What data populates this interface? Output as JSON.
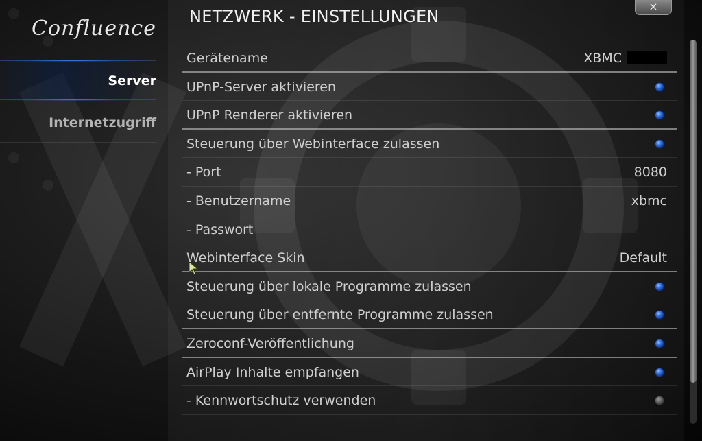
{
  "app": {
    "logo_text": "Confluence",
    "page_title": "NETZWERK - EINSTELLUNGEN",
    "close_label": "×"
  },
  "sidebar": {
    "items": [
      {
        "label": "Server",
        "active": true
      },
      {
        "label": "Internetzugriff",
        "active": false
      }
    ]
  },
  "settings": [
    {
      "label": "Gerätename",
      "value": "XBMC",
      "type": "text",
      "redacted": true,
      "separator": true
    },
    {
      "label": "UPnP-Server aktivieren",
      "type": "radio",
      "checked": true
    },
    {
      "label": "UPnP Renderer aktivieren",
      "type": "radio",
      "checked": true,
      "separator": true
    },
    {
      "label": "Steuerung über Webinterface zulassen",
      "type": "radio",
      "checked": true
    },
    {
      "label": "- Port",
      "value": "8080",
      "type": "text"
    },
    {
      "label": "- Benutzername",
      "value": "xbmc",
      "type": "text"
    },
    {
      "label": "- Passwort",
      "value": "",
      "type": "text"
    },
    {
      "label": "Webinterface Skin",
      "value": "Default",
      "type": "text",
      "separator": true
    },
    {
      "label": "Steuerung über lokale Programme zulassen",
      "type": "radio",
      "checked": true
    },
    {
      "label": "Steuerung über entfernte Programme zulassen",
      "type": "radio",
      "checked": true,
      "separator": true
    },
    {
      "label": "Zeroconf-Veröffentlichung",
      "type": "radio",
      "checked": true,
      "separator": true
    },
    {
      "label": "AirPlay Inhalte empfangen",
      "type": "radio",
      "checked": true
    },
    {
      "label": "- Kennwortschutz verwenden",
      "type": "radio",
      "checked": false
    }
  ],
  "colors": {
    "radio_on": "#2f6fe0",
    "radio_off": "#5c5c5c",
    "accent_glow": "#3c82ff"
  },
  "icons": {
    "close": "close-icon",
    "cursor": "mouse-pointer-icon",
    "background": "gear-background-icon"
  }
}
